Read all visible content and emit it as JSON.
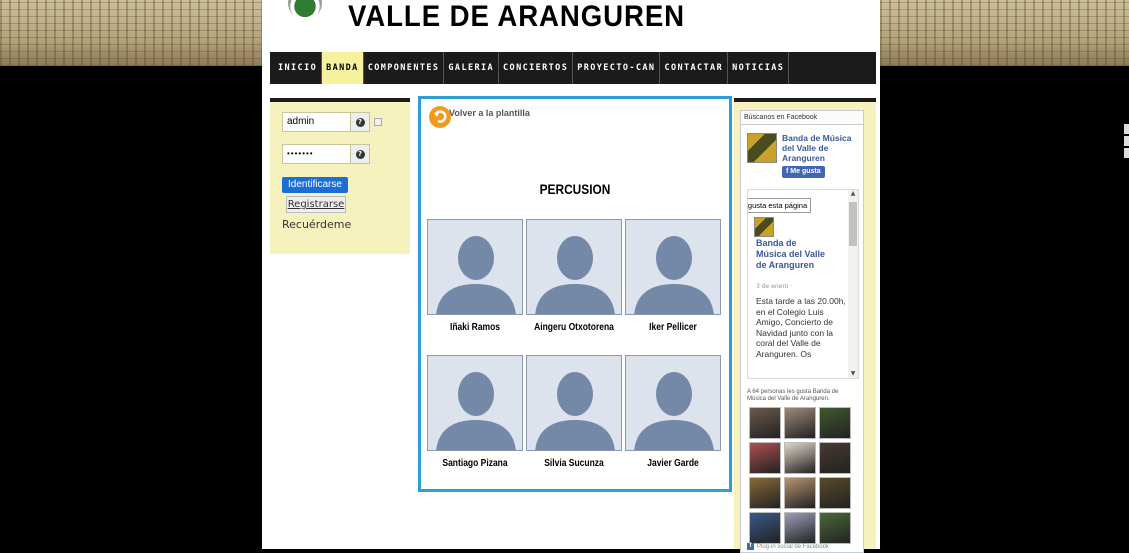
{
  "site": {
    "title": "VALLE DE ARANGUREN"
  },
  "nav": {
    "items": [
      "INICIO",
      "BANDA",
      "COMPONENTES",
      "GALERIA",
      "CONCIERTOS",
      "PROYECTO-CAN",
      "CONTACTAR",
      "NOTICIAS"
    ],
    "active": "BANDA"
  },
  "login": {
    "username": "admin",
    "password": "•••••••",
    "submit_label": "Identificarse",
    "register_label": "Registrarse",
    "remember_label": "Recuérdeme"
  },
  "main": {
    "back_label": "Volver a la plantilla",
    "section_title": "PERCUSION",
    "members": [
      {
        "name": "Iñaki Ramos"
      },
      {
        "name": "Aingeru Otxotorena"
      },
      {
        "name": "Iker Pellicer"
      },
      {
        "name": "Santiago Pizana"
      },
      {
        "name": "Silvia Sucunza"
      },
      {
        "name": "Javier Garde"
      }
    ]
  },
  "facebook": {
    "header": "Búscanos en Facebook",
    "page_name": "Banda de Música del Valle de Aranguren",
    "like_button": "Me gusta",
    "tooltip": "le gusta esta página",
    "post_author": "Banda de Música del Valle de Aranguren",
    "post_date": "3 de enero ·",
    "post_text": "Esta tarde a las 20.00h, en el Colegio Luis Amigo, Concierto de Navidad junto con la coral del Valle de Aranguren. Os",
    "likes_count": "A 64 personas les gusta Banda de Música del Valle de Aranguren.",
    "footer": "Plug-in social de Facebook",
    "face_colors": [
      "#6b5a4a",
      "#a08a78",
      "#3f5a2e",
      "#b05050",
      "#e0d6c8",
      "#4a3a30",
      "#8a6a3a",
      "#b89470",
      "#5a4a2a",
      "#3a5a8a",
      "#9aa0b8",
      "#4a6a3a"
    ]
  },
  "colors": {
    "accent_border": "#2c9fd6",
    "nav_active": "#f5f19e",
    "panel_bg": "#f6f2be",
    "login_button": "#1a6fd6"
  }
}
